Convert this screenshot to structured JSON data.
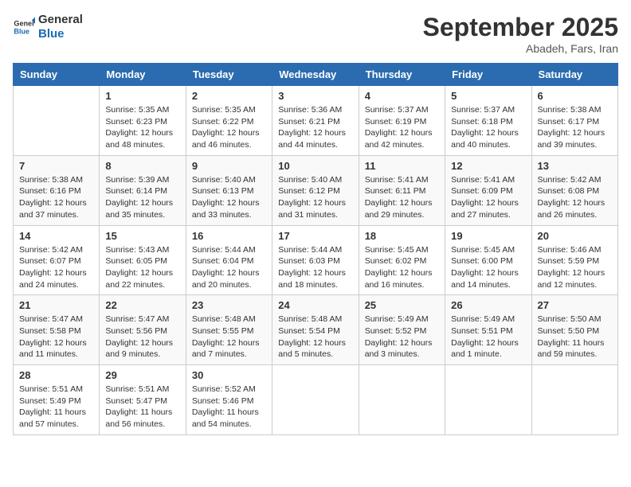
{
  "header": {
    "logo_line1": "General",
    "logo_line2": "Blue",
    "month": "September 2025",
    "location": "Abadeh, Fars, Iran"
  },
  "days_of_week": [
    "Sunday",
    "Monday",
    "Tuesday",
    "Wednesday",
    "Thursday",
    "Friday",
    "Saturday"
  ],
  "weeks": [
    [
      {
        "day": "",
        "content": ""
      },
      {
        "day": "1",
        "content": "Sunrise: 5:35 AM\nSunset: 6:23 PM\nDaylight: 12 hours\nand 48 minutes."
      },
      {
        "day": "2",
        "content": "Sunrise: 5:35 AM\nSunset: 6:22 PM\nDaylight: 12 hours\nand 46 minutes."
      },
      {
        "day": "3",
        "content": "Sunrise: 5:36 AM\nSunset: 6:21 PM\nDaylight: 12 hours\nand 44 minutes."
      },
      {
        "day": "4",
        "content": "Sunrise: 5:37 AM\nSunset: 6:19 PM\nDaylight: 12 hours\nand 42 minutes."
      },
      {
        "day": "5",
        "content": "Sunrise: 5:37 AM\nSunset: 6:18 PM\nDaylight: 12 hours\nand 40 minutes."
      },
      {
        "day": "6",
        "content": "Sunrise: 5:38 AM\nSunset: 6:17 PM\nDaylight: 12 hours\nand 39 minutes."
      }
    ],
    [
      {
        "day": "7",
        "content": "Sunrise: 5:38 AM\nSunset: 6:16 PM\nDaylight: 12 hours\nand 37 minutes."
      },
      {
        "day": "8",
        "content": "Sunrise: 5:39 AM\nSunset: 6:14 PM\nDaylight: 12 hours\nand 35 minutes."
      },
      {
        "day": "9",
        "content": "Sunrise: 5:40 AM\nSunset: 6:13 PM\nDaylight: 12 hours\nand 33 minutes."
      },
      {
        "day": "10",
        "content": "Sunrise: 5:40 AM\nSunset: 6:12 PM\nDaylight: 12 hours\nand 31 minutes."
      },
      {
        "day": "11",
        "content": "Sunrise: 5:41 AM\nSunset: 6:11 PM\nDaylight: 12 hours\nand 29 minutes."
      },
      {
        "day": "12",
        "content": "Sunrise: 5:41 AM\nSunset: 6:09 PM\nDaylight: 12 hours\nand 27 minutes."
      },
      {
        "day": "13",
        "content": "Sunrise: 5:42 AM\nSunset: 6:08 PM\nDaylight: 12 hours\nand 26 minutes."
      }
    ],
    [
      {
        "day": "14",
        "content": "Sunrise: 5:42 AM\nSunset: 6:07 PM\nDaylight: 12 hours\nand 24 minutes."
      },
      {
        "day": "15",
        "content": "Sunrise: 5:43 AM\nSunset: 6:05 PM\nDaylight: 12 hours\nand 22 minutes."
      },
      {
        "day": "16",
        "content": "Sunrise: 5:44 AM\nSunset: 6:04 PM\nDaylight: 12 hours\nand 20 minutes."
      },
      {
        "day": "17",
        "content": "Sunrise: 5:44 AM\nSunset: 6:03 PM\nDaylight: 12 hours\nand 18 minutes."
      },
      {
        "day": "18",
        "content": "Sunrise: 5:45 AM\nSunset: 6:02 PM\nDaylight: 12 hours\nand 16 minutes."
      },
      {
        "day": "19",
        "content": "Sunrise: 5:45 AM\nSunset: 6:00 PM\nDaylight: 12 hours\nand 14 minutes."
      },
      {
        "day": "20",
        "content": "Sunrise: 5:46 AM\nSunset: 5:59 PM\nDaylight: 12 hours\nand 12 minutes."
      }
    ],
    [
      {
        "day": "21",
        "content": "Sunrise: 5:47 AM\nSunset: 5:58 PM\nDaylight: 12 hours\nand 11 minutes."
      },
      {
        "day": "22",
        "content": "Sunrise: 5:47 AM\nSunset: 5:56 PM\nDaylight: 12 hours\nand 9 minutes."
      },
      {
        "day": "23",
        "content": "Sunrise: 5:48 AM\nSunset: 5:55 PM\nDaylight: 12 hours\nand 7 minutes."
      },
      {
        "day": "24",
        "content": "Sunrise: 5:48 AM\nSunset: 5:54 PM\nDaylight: 12 hours\nand 5 minutes."
      },
      {
        "day": "25",
        "content": "Sunrise: 5:49 AM\nSunset: 5:52 PM\nDaylight: 12 hours\nand 3 minutes."
      },
      {
        "day": "26",
        "content": "Sunrise: 5:49 AM\nSunset: 5:51 PM\nDaylight: 12 hours\nand 1 minute."
      },
      {
        "day": "27",
        "content": "Sunrise: 5:50 AM\nSunset: 5:50 PM\nDaylight: 11 hours\nand 59 minutes."
      }
    ],
    [
      {
        "day": "28",
        "content": "Sunrise: 5:51 AM\nSunset: 5:49 PM\nDaylight: 11 hours\nand 57 minutes."
      },
      {
        "day": "29",
        "content": "Sunrise: 5:51 AM\nSunset: 5:47 PM\nDaylight: 11 hours\nand 56 minutes."
      },
      {
        "day": "30",
        "content": "Sunrise: 5:52 AM\nSunset: 5:46 PM\nDaylight: 11 hours\nand 54 minutes."
      },
      {
        "day": "",
        "content": ""
      },
      {
        "day": "",
        "content": ""
      },
      {
        "day": "",
        "content": ""
      },
      {
        "day": "",
        "content": ""
      }
    ]
  ]
}
